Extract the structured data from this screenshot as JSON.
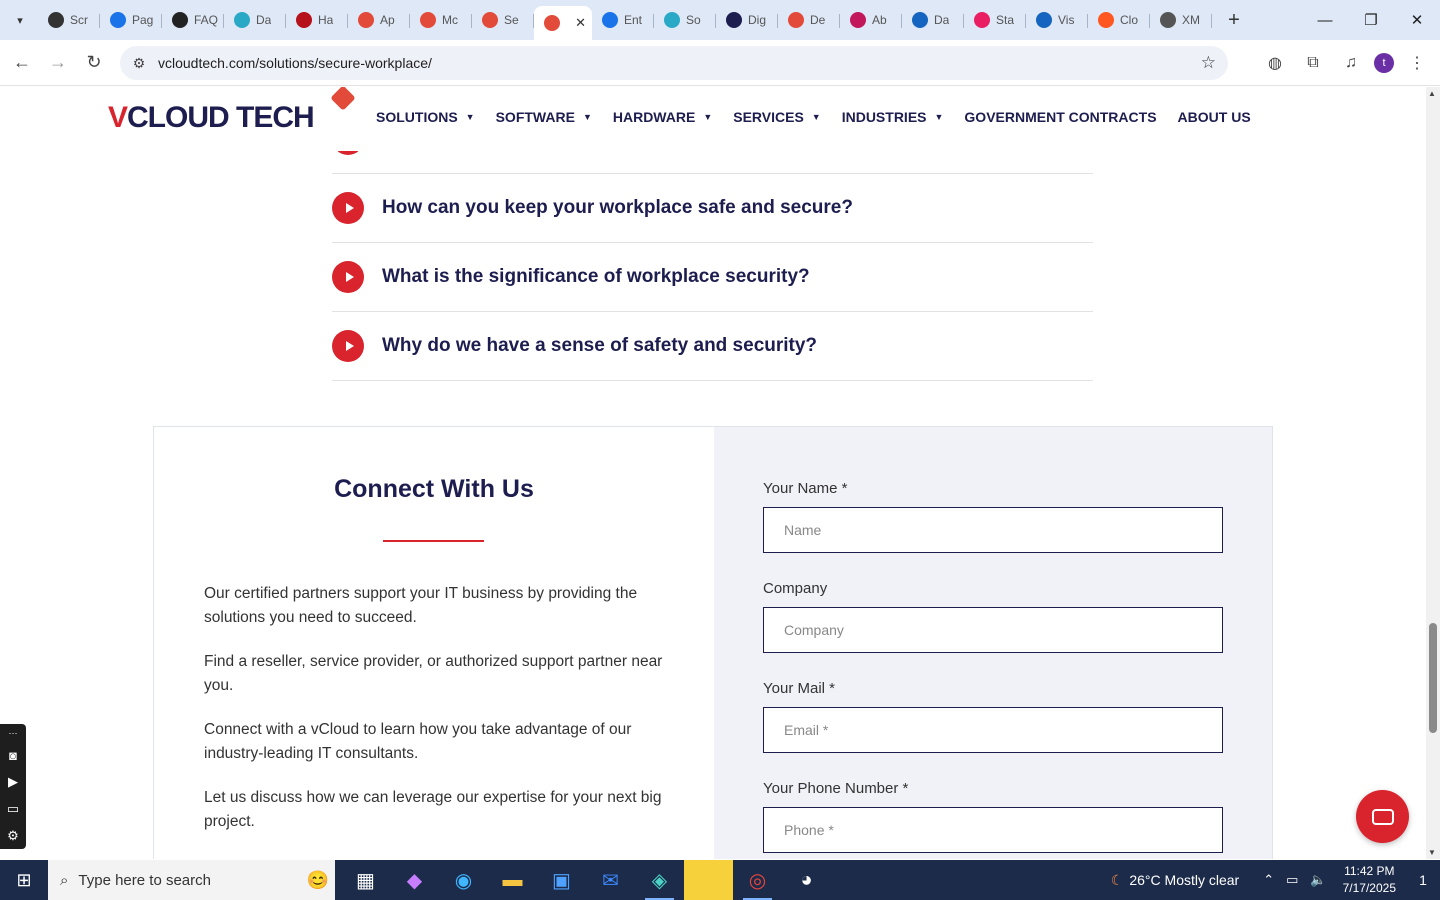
{
  "browser": {
    "tabs": [
      {
        "title": "Scr",
        "color": "#333333"
      },
      {
        "title": "Pag",
        "color": "#1a73e8"
      },
      {
        "title": "FAQ",
        "color": "#222222"
      },
      {
        "title": "Da",
        "color": "#2aa9c7"
      },
      {
        "title": "Ha",
        "color": "#b5121b"
      },
      {
        "title": "Ap",
        "color": "#e24a3a"
      },
      {
        "title": "Mc",
        "color": "#e24a3a"
      },
      {
        "title": "Se",
        "color": "#e24a3a"
      },
      {
        "title": "",
        "color": "#e24a3a",
        "active": true
      },
      {
        "title": "Ent",
        "color": "#1a73e8"
      },
      {
        "title": "So",
        "color": "#2aa9c7"
      },
      {
        "title": "Dig",
        "color": "#1d1d4f"
      },
      {
        "title": "De",
        "color": "#e24a3a"
      },
      {
        "title": "Ab",
        "color": "#c2185b"
      },
      {
        "title": "Da",
        "color": "#1565c0"
      },
      {
        "title": "Sta",
        "color": "#e91e63"
      },
      {
        "title": "Vis",
        "color": "#1565c0"
      },
      {
        "title": "Clo",
        "color": "#ff5722"
      },
      {
        "title": "XM",
        "color": "#555555"
      }
    ],
    "url": "vcloudtech.com/solutions/secure-workplace/",
    "profile_initial": "t"
  },
  "site": {
    "logo": {
      "v": "V",
      "rest": "CLOUD TECH"
    },
    "nav": [
      {
        "label": "SOLUTIONS",
        "caret": true
      },
      {
        "label": "SOFTWARE",
        "caret": true
      },
      {
        "label": "HARDWARE",
        "caret": true
      },
      {
        "label": "SERVICES",
        "caret": true
      },
      {
        "label": "INDUSTRIES",
        "caret": true
      },
      {
        "label": "GOVERNMENT CONTRACTS",
        "caret": false
      },
      {
        "label": "ABOUT US",
        "caret": false
      }
    ]
  },
  "faq": [
    "How can you keep your workplace safe and secure?",
    "What is the significance of workplace security?",
    "Why do we have a sense of safety and security?"
  ],
  "connect": {
    "title": "Connect With Us",
    "paragraphs": [
      "Our certified partners support your IT business by providing the solutions you need to succeed.",
      "Find a reseller, service provider, or authorized support partner near you.",
      "Connect with a vCloud to learn how you take advantage of our industry-leading IT consultants.",
      "Let us discuss how we can leverage our expertise for your next big project."
    ],
    "form": [
      {
        "label": "Your Name *",
        "placeholder": "Name"
      },
      {
        "label": "Company",
        "placeholder": "Company"
      },
      {
        "label": "Your Mail *",
        "placeholder": "Email *"
      },
      {
        "label": "Your Phone Number *",
        "placeholder": "Phone *"
      }
    ]
  },
  "taskbar": {
    "search_placeholder": "Type here to search",
    "weather": "26°C  Mostly clear",
    "time": "11:42 PM",
    "date": "7/17/2025",
    "notifications": "1"
  }
}
